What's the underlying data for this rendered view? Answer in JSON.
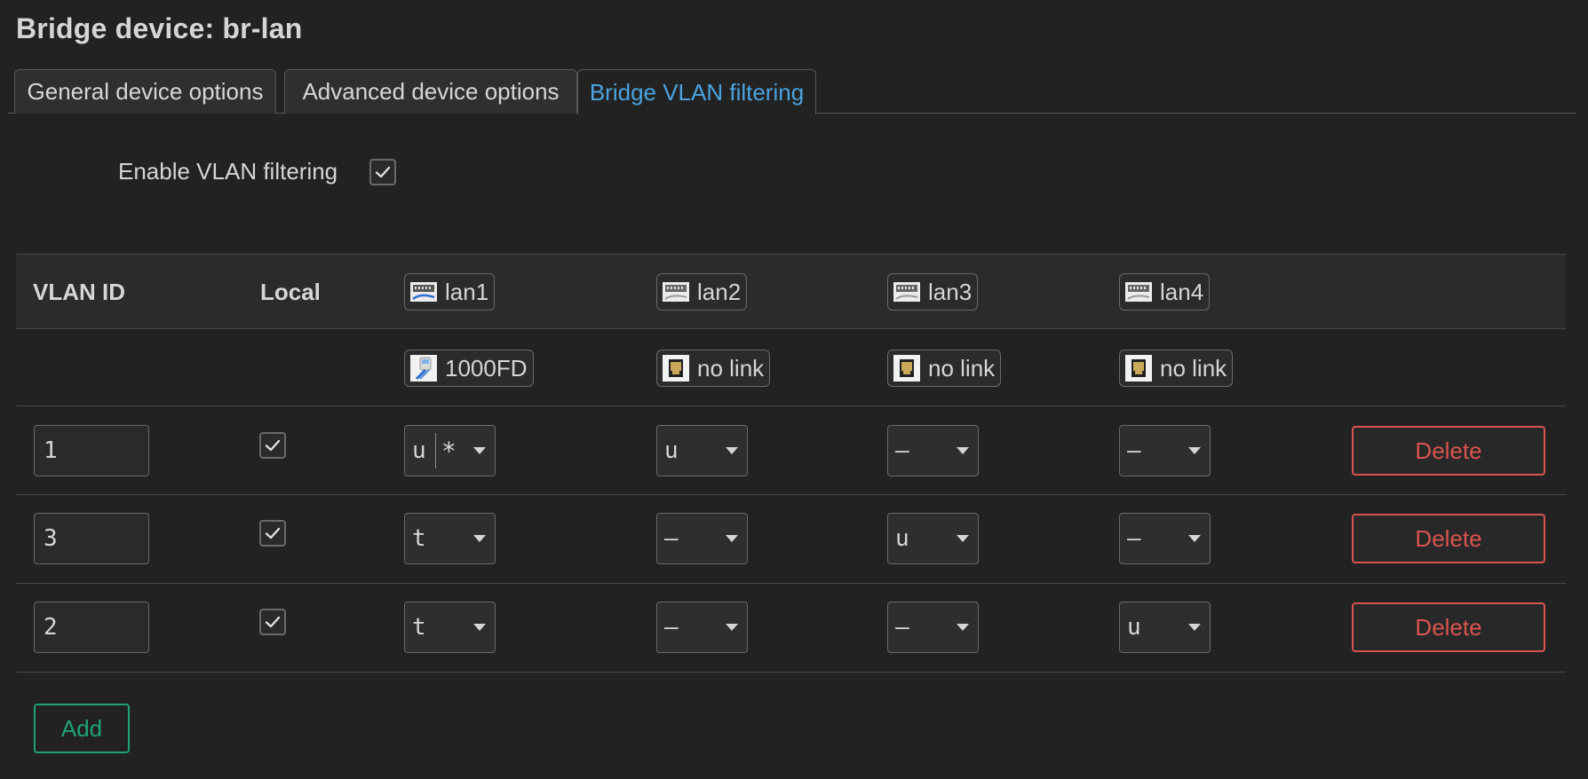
{
  "title": "Bridge device: br-lan",
  "tabs": [
    {
      "label": "General device options",
      "active": false
    },
    {
      "label": "Advanced device options",
      "active": false
    },
    {
      "label": "Bridge VLAN filtering",
      "active": true
    }
  ],
  "enable_filtering": {
    "label": "Enable VLAN filtering",
    "checked": true
  },
  "table": {
    "headers": {
      "vlan_id": "VLAN ID",
      "local": "Local"
    },
    "ports": [
      {
        "name": "lan1",
        "status": "1000FD",
        "icon": "ethernet-port-icon",
        "status_icon": "ethernet-connected-icon"
      },
      {
        "name": "lan2",
        "status": "no link",
        "icon": "ethernet-port-icon",
        "status_icon": "ethernet-nolink-icon"
      },
      {
        "name": "lan3",
        "status": "no link",
        "icon": "ethernet-port-icon",
        "status_icon": "ethernet-nolink-icon"
      },
      {
        "name": "lan4",
        "status": "no link",
        "icon": "ethernet-port-icon",
        "status_icon": "ethernet-nolink-icon"
      }
    ],
    "rows": [
      {
        "vlan_id": "1",
        "local": true,
        "ports": [
          "u",
          "u",
          "–",
          "–"
        ],
        "lan1_primary": "*",
        "delete_label": "Delete"
      },
      {
        "vlan_id": "3",
        "local": true,
        "ports": [
          "t",
          "–",
          "u",
          "–"
        ],
        "delete_label": "Delete"
      },
      {
        "vlan_id": "2",
        "local": true,
        "ports": [
          "t",
          "–",
          "–",
          "u"
        ],
        "delete_label": "Delete"
      }
    ]
  },
  "add_label": "Add",
  "colors": {
    "accent": "#4aa3df",
    "danger": "#d9534f",
    "success": "#1ea371",
    "background": "#222222"
  }
}
